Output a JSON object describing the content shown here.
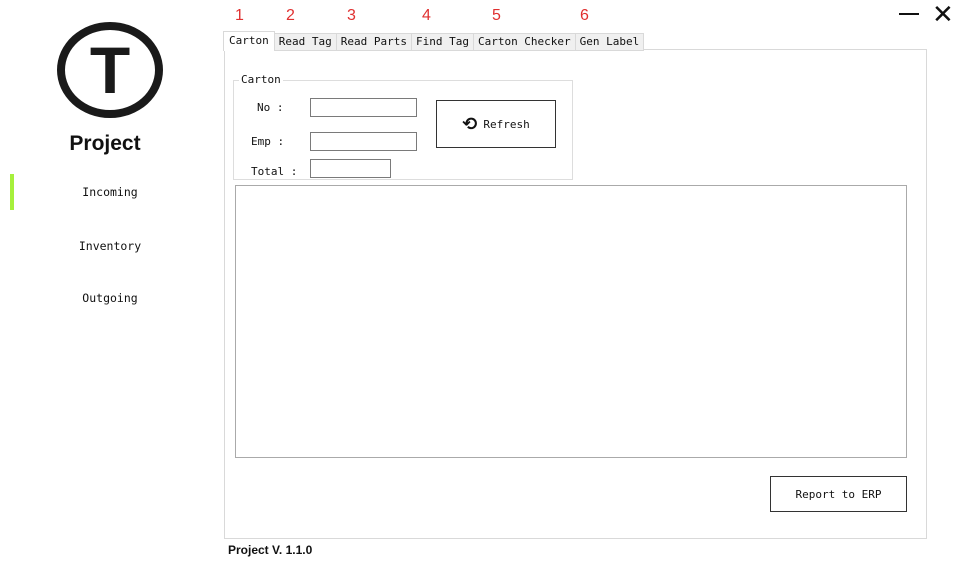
{
  "sidebar": {
    "brand_letter": "T",
    "brand": "Project",
    "items": [
      {
        "label": "Incoming"
      },
      {
        "label": "Inventory"
      },
      {
        "label": "Outgoing"
      }
    ]
  },
  "tabs": [
    {
      "num": "1",
      "label": "Carton"
    },
    {
      "num": "2",
      "label": "Read Tag"
    },
    {
      "num": "3",
      "label": "Read Parts"
    },
    {
      "num": "4",
      "label": "Find Tag"
    },
    {
      "num": "5",
      "label": "Carton Checker"
    },
    {
      "num": "6",
      "label": "Gen Label"
    }
  ],
  "carton": {
    "group_label": "Carton",
    "no_label": "No :",
    "emp_label": "Emp :",
    "total_label": "Total :",
    "no_value": "",
    "emp_value": "",
    "total_value": "",
    "refresh": "Refresh"
  },
  "report_button": "Report to ERP",
  "version": "Project V. 1.1.0",
  "colors": {
    "active_indicator": "#a6f03c",
    "annotation": "#e03030"
  }
}
